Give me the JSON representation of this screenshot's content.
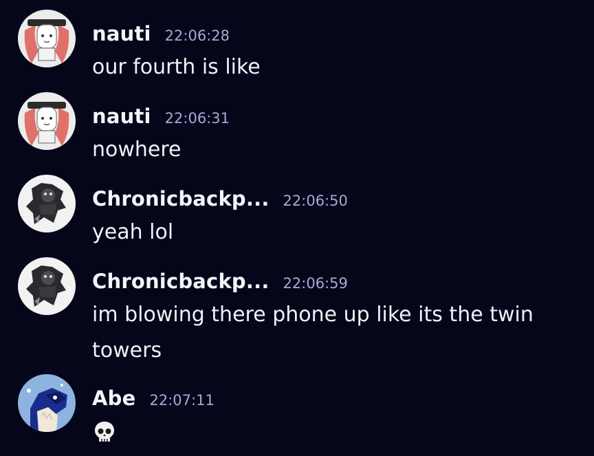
{
  "colors": {
    "background": "#06061a",
    "username": "#f4f4fb",
    "timestamp": "#a9a8d8",
    "message_text": "#f1f1f7"
  },
  "messages": [
    {
      "username": "nauti",
      "timestamp": "22:06:28",
      "text": "our fourth is like",
      "avatar": "red-haired-character-avatar"
    },
    {
      "username": "nauti",
      "timestamp": "22:06:31",
      "text": "nowhere",
      "avatar": "red-haired-character-avatar"
    },
    {
      "username": "Chronicbackp...",
      "timestamp": "22:06:50",
      "text": "yeah lol",
      "avatar": "dark-character-avatar"
    },
    {
      "username": "Chronicbackp...",
      "timestamp": "22:06:59",
      "text": "im blowing there phone up like its the twin towers",
      "avatar": "dark-character-avatar"
    },
    {
      "username": "Abe",
      "timestamp": "22:07:11",
      "text": "",
      "emoji": "skull-emoji",
      "avatar": "blue-dog-avatar"
    }
  ]
}
